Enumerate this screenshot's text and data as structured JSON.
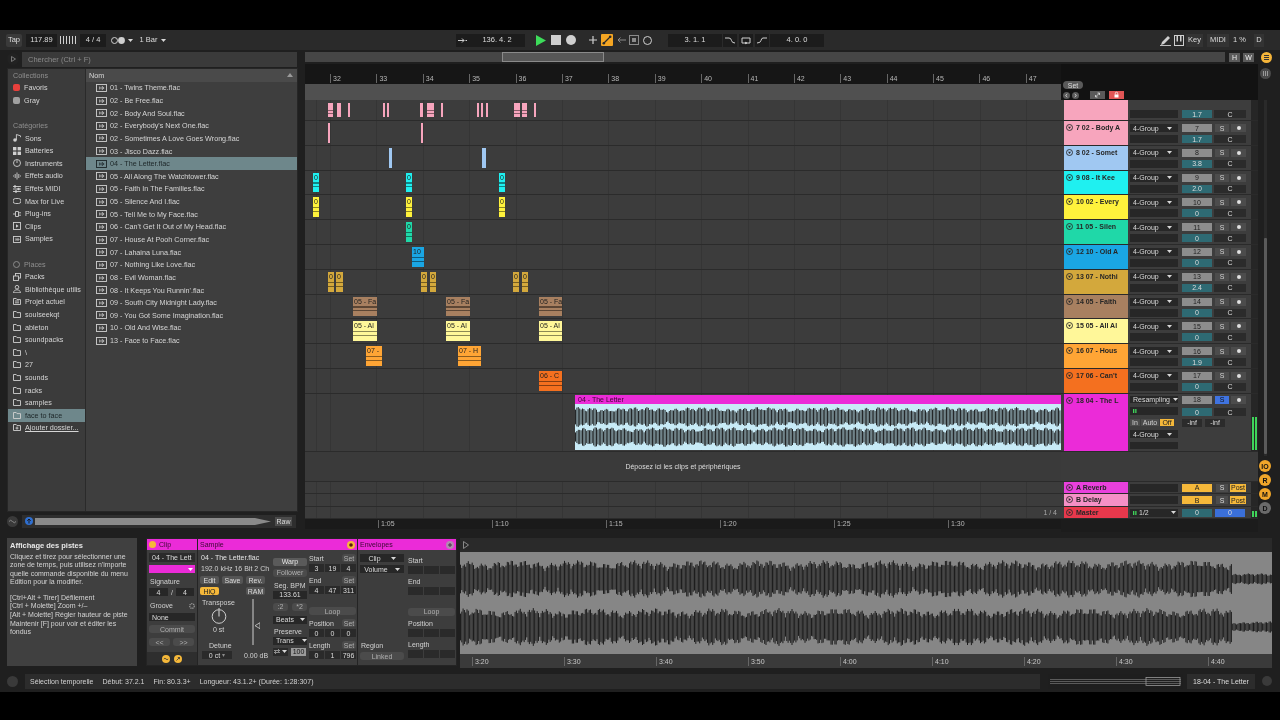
{
  "control_bar": {
    "tap": "Tap",
    "tempo": "117.89",
    "signature": "4 / 4",
    "quantize": "1 Bar",
    "position": "136. 4. 2",
    "playing": true,
    "automation_arm": true,
    "loop_start": "3. 1. 1",
    "loop_length": "4. 0. 0",
    "key": "Key",
    "midi": "MIDI",
    "cpu": "1 %",
    "disk": "D"
  },
  "browser": {
    "search": {
      "placeholder": "Chercher (Ctrl + F)"
    },
    "sidebar": [
      {
        "kind": "collections",
        "heading": "Collections",
        "items": [
          {
            "label": "Favoris",
            "kind": "tag",
            "color": "#e8403c",
            "selected": false
          },
          {
            "label": "Gray",
            "kind": "tag",
            "color": "#a0a0a0",
            "selected": false
          }
        ]
      },
      {
        "kind": "categories",
        "heading": "Catégories",
        "items": [
          {
            "label": "Sons",
            "kind": "sounds",
            "selected": false
          },
          {
            "label": "Batteries",
            "kind": "drums",
            "selected": false
          },
          {
            "label": "Instruments",
            "kind": "instruments",
            "selected": false
          },
          {
            "label": "Effets audio",
            "kind": "audio",
            "selected": false
          },
          {
            "label": "Effets MIDI",
            "kind": "midi",
            "selected": false
          },
          {
            "label": "Max for Live",
            "kind": "max",
            "selected": false
          },
          {
            "label": "Plug-ins",
            "kind": "plugins",
            "selected": false
          },
          {
            "label": "Clips",
            "kind": "clips",
            "selected": false
          },
          {
            "label": "Samples",
            "kind": "samples",
            "selected": false
          }
        ]
      },
      {
        "kind": "places",
        "heading": "Places",
        "items": [
          {
            "label": "Packs",
            "kind": "packs",
            "selected": false
          },
          {
            "label": "Bibliothèque utilis",
            "kind": "library",
            "selected": false
          },
          {
            "label": "Projet actuel",
            "kind": "project",
            "selected": false
          },
          {
            "label": "soulseekqt",
            "kind": "folder",
            "selected": false
          },
          {
            "label": "ableton",
            "kind": "folder",
            "selected": false
          },
          {
            "label": "soundpacks",
            "kind": "folder",
            "selected": false
          },
          {
            "label": "\\",
            "kind": "folder",
            "selected": false
          },
          {
            "label": "27",
            "kind": "folder",
            "selected": false
          },
          {
            "label": "sounds",
            "kind": "folder",
            "selected": false
          },
          {
            "label": "racks",
            "kind": "folder",
            "selected": false
          },
          {
            "label": "samples",
            "kind": "folder",
            "selected": false
          },
          {
            "label": "face to face",
            "kind": "folder",
            "selected": true
          },
          {
            "label": "Ajouter dossier...",
            "kind": "add",
            "selected": false
          }
        ]
      }
    ],
    "files": {
      "column": "Nom",
      "items": [
        {
          "label": "01 - Twins Theme.flac",
          "selected": false
        },
        {
          "label": "02 - Be Free.flac",
          "selected": false
        },
        {
          "label": "02 - Body And Soul.flac",
          "selected": false
        },
        {
          "label": "02 - Everybody's Next One.flac",
          "selected": false
        },
        {
          "label": "02 - Sometimes A Love Goes Wrong.flac",
          "selected": false
        },
        {
          "label": "03 - Jisco Dazz.flac",
          "selected": false
        },
        {
          "label": "04 - The Letter.flac",
          "selected": true
        },
        {
          "label": "05 - All Along The Watchtower.flac",
          "selected": false
        },
        {
          "label": "05 - Faith In The Families.flac",
          "selected": false
        },
        {
          "label": "05 - Silence And I.flac",
          "selected": false
        },
        {
          "label": "05 - Tell Me to My Face.flac",
          "selected": false
        },
        {
          "label": "06 - Can't Get It Out of My Head.flac",
          "selected": false
        },
        {
          "label": "07 - House At Pooh Corner.flac",
          "selected": false
        },
        {
          "label": "07 - Lahaina Luna.flac",
          "selected": false
        },
        {
          "label": "07 - Nothing Like Love.flac",
          "selected": false
        },
        {
          "label": "08 - Evil Woman.flac",
          "selected": false
        },
        {
          "label": "08 - It Keeps You Runnin'.flac",
          "selected": false
        },
        {
          "label": "09 - South City Midnight Lady.flac",
          "selected": false
        },
        {
          "label": "09 - You Got Some Imagination.flac",
          "selected": false
        },
        {
          "label": "10 - Old And Wise.flac",
          "selected": false
        },
        {
          "label": "13 - Face to Face.flac",
          "selected": false
        }
      ]
    },
    "preview": {
      "raw": "Raw"
    }
  },
  "arrangement": {
    "overview_buttons": [
      "H",
      "W"
    ],
    "ruler": [
      "32",
      "33",
      "34",
      "35",
      "36",
      "37",
      "38",
      "39",
      "40",
      "41",
      "42",
      "43",
      "44",
      "45",
      "46",
      "47"
    ],
    "set": "Set",
    "tracks": [
      {
        "kind": "partial",
        "color": "#f7a5bd",
        "volume": "1.7",
        "pan": "C"
      },
      {
        "kind": "audio",
        "name": "7 02 - Body A",
        "color": "#f7a5bd",
        "routing": "4-Group",
        "number": "7",
        "solo": {
          "label": "S",
          "on": false
        },
        "volume": "1.7",
        "pan": "C"
      },
      {
        "kind": "audio",
        "name": "8 02 - Somet",
        "color": "#a0c8f2",
        "routing": "4-Group",
        "number": "8",
        "solo": {
          "label": "S",
          "on": false
        },
        "volume": "3.8",
        "pan": "C"
      },
      {
        "kind": "audio",
        "name": "9 08 - It Kee",
        "color": "#1ff0f0",
        "routing": "4-Group",
        "number": "9",
        "solo": {
          "label": "S",
          "on": false
        },
        "volume": "2.0",
        "pan": "C",
        "clips": [
          "0",
          "0",
          "0"
        ]
      },
      {
        "kind": "audio",
        "name": "10 02 - Every",
        "color": "#fff23c",
        "routing": "4-Group",
        "number": "10",
        "solo": {
          "label": "S",
          "on": false
        },
        "volume": "0",
        "pan": "C",
        "clips": [
          "0",
          "0",
          "0"
        ]
      },
      {
        "kind": "audio",
        "name": "11 05 - Silen",
        "color": "#1fd8a8",
        "routing": "4-Group",
        "number": "11",
        "solo": {
          "label": "S",
          "on": false
        },
        "volume": "0",
        "pan": "C",
        "clips": [
          "0"
        ]
      },
      {
        "kind": "audio",
        "name": "12 10 - Old A",
        "color": "#1aa6e4",
        "routing": "4-Group",
        "number": "12",
        "solo": {
          "label": "S",
          "on": false
        },
        "volume": "0",
        "pan": "C",
        "clips": [
          "10"
        ]
      },
      {
        "kind": "audio",
        "name": "13 07 - Nothi",
        "color": "#d3a83c",
        "routing": "4-Group",
        "number": "13",
        "solo": {
          "label": "S",
          "on": false
        },
        "volume": "2.4",
        "pan": "C",
        "clips": [
          "0",
          "0",
          "0",
          "0",
          "0",
          "0"
        ]
      },
      {
        "kind": "audio",
        "name": "14 05 - Faith",
        "color": "#a88060",
        "routing": "4-Group",
        "number": "14",
        "solo": {
          "label": "S",
          "on": false
        },
        "volume": "0",
        "pan": "C",
        "clips": [
          "05 - Fa",
          "05 - Fa",
          "05 - Fa"
        ]
      },
      {
        "kind": "audio",
        "name": "15 05 - All Al",
        "color": "#fff799",
        "routing": "4-Group",
        "number": "15",
        "solo": {
          "label": "S",
          "on": false
        },
        "volume": "0",
        "pan": "C",
        "clips": [
          "05 - Al",
          "05 - Al",
          "05 - Al"
        ]
      },
      {
        "kind": "audio",
        "name": "16 07 - Hous",
        "color": "#ffa535",
        "routing": "4-Group",
        "number": "16",
        "solo": {
          "label": "S",
          "on": false
        },
        "volume": "1.9",
        "pan": "C",
        "clips": [
          "07 -",
          "07 - H"
        ]
      },
      {
        "kind": "audio",
        "name": "17 06 - Can't",
        "color": "#f4701f",
        "routing": "4-Group",
        "number": "17",
        "solo": {
          "label": "S",
          "on": false
        },
        "volume": "0",
        "pan": "C",
        "clips": [
          "06 - C"
        ]
      },
      {
        "kind": "resampling",
        "name": "18 04 - The L",
        "color": "#eb2bd8",
        "input": "Resampling",
        "monitor": [
          {
            "label": "In",
            "selected": false
          },
          {
            "label": "Auto",
            "selected": false
          },
          {
            "label": "Off",
            "selected": true
          }
        ],
        "routing": "4-Group",
        "number": "18",
        "solo": {
          "label": "S",
          "on": true
        },
        "volume": "0",
        "pan": "C",
        "peaks": [
          "-inf",
          "-inf"
        ],
        "clips": [
          "04 - The Letter"
        ]
      }
    ],
    "drop_hint": "Déposez ici les clips et périphériques",
    "returns": [
      {
        "kind": "return",
        "name": "A Reverb",
        "color": "#e940dc",
        "send": "A",
        "solo": {
          "label": "S",
          "on": false
        },
        "mode": "Post"
      },
      {
        "kind": "return",
        "name": "B Delay",
        "color": "#f590c6",
        "send": "B",
        "solo": {
          "label": "S",
          "on": false
        },
        "mode": "Post"
      },
      {
        "kind": "master",
        "name": "Master",
        "color": "#e8384c",
        "routing": "1/2",
        "volume": "0",
        "cue": "0"
      }
    ],
    "zoom_label": "1 / 4",
    "time_ruler": [
      "1:05",
      "1:10",
      "1:15",
      "1:20",
      "1:25",
      "1:30"
    ],
    "view_toggles": [
      {
        "label": "IO",
        "on": true
      },
      {
        "label": "R",
        "on": true
      },
      {
        "label": "M",
        "on": true
      },
      {
        "label": "D",
        "on": false
      }
    ]
  },
  "info": {
    "title": "Affichage des pistes",
    "text": "Cliquez et tirez pour sélectionner une zone de temps, puis utilisez n'importe quelle commande disponible du menu Edition pour la modifier.",
    "shortcuts": [
      "[Ctrl+Alt + Tirer] Défilement",
      "[Ctrl + Molette] Zoom +/–",
      "[Alt + Molette] Régler hauteur de piste",
      "Maintenir [F] pour voir et éditer les fondus"
    ]
  },
  "clip_view": {
    "clip": {
      "title": "Clip",
      "name": "04 - The Lett",
      "color": "#eb2bd8",
      "signature_label": "Signature",
      "signature": {
        "numerator": "4",
        "separator": "/",
        "denominator": "4"
      },
      "groove_label": "Groove",
      "groove": "None",
      "commit": "Commit",
      "nudge": [
        "<<",
        ">>"
      ]
    },
    "sample": {
      "title": "Sample",
      "file": "04 - The Letter.flac",
      "format": "192.0 kHz 16 Bit 2 Ch",
      "buttons": [
        "Edit",
        "Save",
        "Rev."
      ],
      "hiq": {
        "label": "HiQ",
        "on": true
      },
      "ram": {
        "label": "RAM",
        "on": false
      },
      "transpose": {
        "label": "Transpose",
        "value": "0 st"
      },
      "detune": {
        "label": "Detune",
        "value": "0 ct"
      },
      "gain": {
        "value": "0.00 dB",
        "level": 0.42
      },
      "warp": {
        "label": "Warp",
        "on": false
      },
      "follower": "Follower",
      "seg_bpm": {
        "label": "Seg. BPM",
        "value": "133.61"
      },
      "tempo_buttons": [
        ":2",
        "*2"
      ],
      "warp_mode": "Beats",
      "preserve": {
        "label": "Preserve",
        "value": "Trans"
      },
      "grain": "100",
      "markers": [
        {
          "label": "Start",
          "set": "Set",
          "values": [
            "3",
            "19",
            "4"
          ]
        },
        {
          "label": "End",
          "set": "Set",
          "values": [
            "4",
            "47",
            "311"
          ]
        }
      ],
      "loop": "Loop",
      "loop_markers": [
        {
          "label": "Position",
          "set": "Set",
          "values": [
            "0",
            "0",
            "0"
          ]
        },
        {
          "label": "Length",
          "set": "Set",
          "values": [
            "0",
            "1",
            "796"
          ]
        }
      ]
    },
    "envelopes": {
      "title": "Envelopes",
      "device": "Clip",
      "control": "Volume",
      "region_label": "Region",
      "region": "Linked",
      "markers": [
        "Start",
        "End"
      ],
      "loop": "Loop",
      "loop_markers": [
        "Position",
        "Length"
      ]
    }
  },
  "sample_editor": {
    "time_ruler": [
      "3:20",
      "3:30",
      "3:40",
      "3:50",
      "4:00",
      "4:10",
      "4:20",
      "4:30",
      "4:40"
    ]
  },
  "status_bar": {
    "items": [
      "Sélection temporelle",
      "Début: 37.2.1",
      "Fin: 80.3.3+",
      "Longueur: 43.1.2+ (Durée: 1:28:307)"
    ],
    "track": "18-04 - The Letter"
  }
}
